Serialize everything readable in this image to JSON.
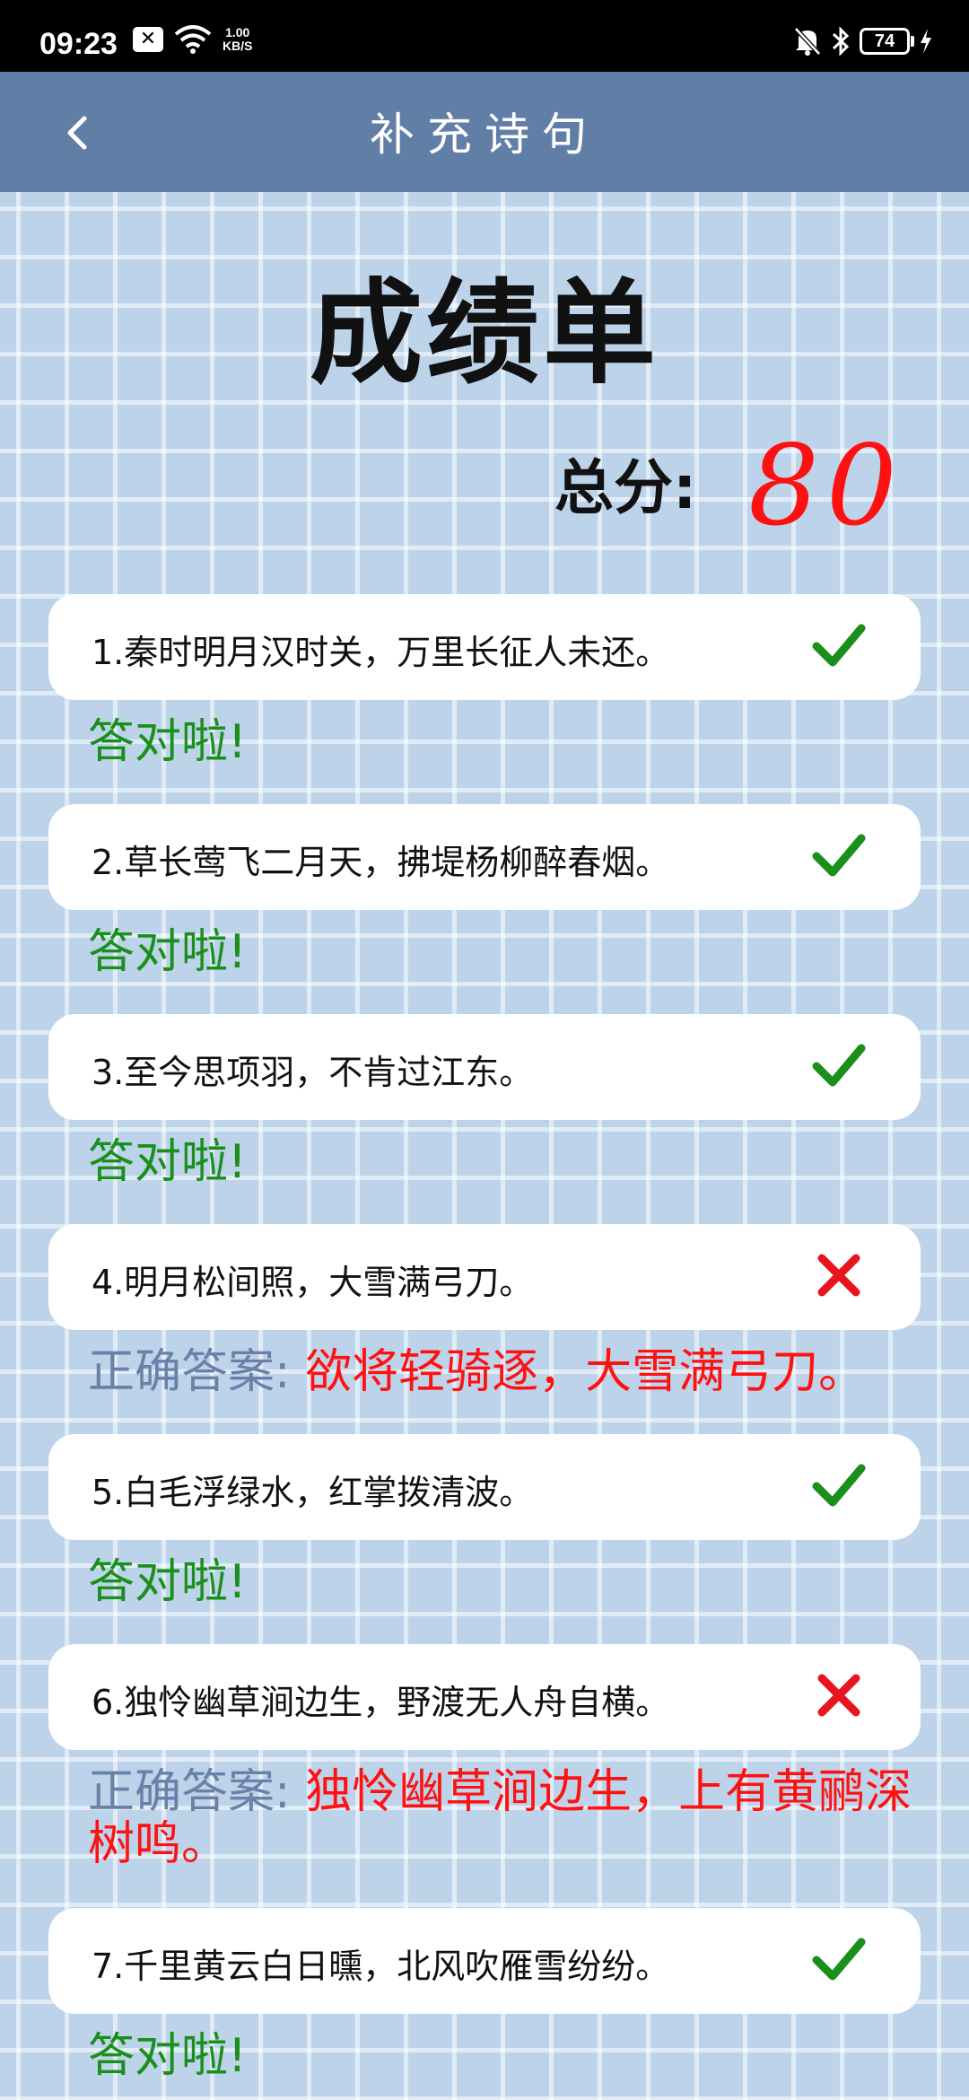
{
  "status_bar": {
    "time": "09:23",
    "net_speed_value": "1.00",
    "net_speed_unit": "KB/S",
    "battery": "74"
  },
  "app_bar": {
    "title": "补充诗句",
    "back_icon": "chevron-left-icon"
  },
  "report": {
    "heading": "成绩单",
    "score_label": "总分:",
    "score_value": "80"
  },
  "questions": [
    {
      "text": "1.秦时明月汉时关，万里长征人未还。",
      "result": "correct",
      "feedback": "答对啦!"
    },
    {
      "text": "2.草长莺飞二月天，拂堤杨柳醉春烟。",
      "result": "correct",
      "feedback": "答对啦!"
    },
    {
      "text": "3.至今思项羽，不肯过江东。",
      "result": "correct",
      "feedback": "答对啦!"
    },
    {
      "text": "4.明月松间照，大雪满弓刀。",
      "result": "wrong",
      "feedback_label": "正确答案:",
      "correct_answer": "欲将轻骑逐，大雪满弓刀。"
    },
    {
      "text": "5.白毛浮绿水，红掌拨清波。",
      "result": "correct",
      "feedback": "答对啦!"
    },
    {
      "text": "6.独怜幽草涧边生，野渡无人舟自横。",
      "result": "wrong",
      "feedback_label": "正确答案:",
      "correct_answer": "独怜幽草涧边生，上有黄鹂深树鸣。"
    },
    {
      "text": "7.千里黄云白日曛，北风吹雁雪纷纷。",
      "result": "correct",
      "feedback": "答对啦!"
    }
  ],
  "colors": {
    "app_bar": "#617fa6",
    "correct": "#1a8f1a",
    "wrong": "#e8141e",
    "answer_label": "#6a80a8",
    "score": "#ff1111"
  }
}
